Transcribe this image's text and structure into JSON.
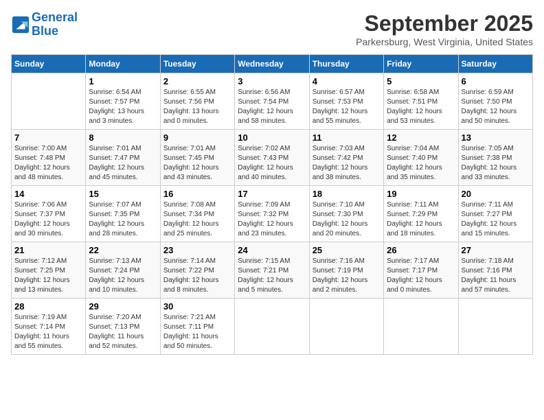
{
  "header": {
    "logo_line1": "General",
    "logo_line2": "Blue",
    "month": "September 2025",
    "location": "Parkersburg, West Virginia, United States"
  },
  "weekdays": [
    "Sunday",
    "Monday",
    "Tuesday",
    "Wednesday",
    "Thursday",
    "Friday",
    "Saturday"
  ],
  "weeks": [
    [
      {
        "day": "",
        "info": ""
      },
      {
        "day": "1",
        "info": "Sunrise: 6:54 AM\nSunset: 7:57 PM\nDaylight: 13 hours\nand 3 minutes."
      },
      {
        "day": "2",
        "info": "Sunrise: 6:55 AM\nSunset: 7:56 PM\nDaylight: 13 hours\nand 0 minutes."
      },
      {
        "day": "3",
        "info": "Sunrise: 6:56 AM\nSunset: 7:54 PM\nDaylight: 12 hours\nand 58 minutes."
      },
      {
        "day": "4",
        "info": "Sunrise: 6:57 AM\nSunset: 7:53 PM\nDaylight: 12 hours\nand 55 minutes."
      },
      {
        "day": "5",
        "info": "Sunrise: 6:58 AM\nSunset: 7:51 PM\nDaylight: 12 hours\nand 53 minutes."
      },
      {
        "day": "6",
        "info": "Sunrise: 6:59 AM\nSunset: 7:50 PM\nDaylight: 12 hours\nand 50 minutes."
      }
    ],
    [
      {
        "day": "7",
        "info": "Sunrise: 7:00 AM\nSunset: 7:48 PM\nDaylight: 12 hours\nand 48 minutes."
      },
      {
        "day": "8",
        "info": "Sunrise: 7:01 AM\nSunset: 7:47 PM\nDaylight: 12 hours\nand 45 minutes."
      },
      {
        "day": "9",
        "info": "Sunrise: 7:01 AM\nSunset: 7:45 PM\nDaylight: 12 hours\nand 43 minutes."
      },
      {
        "day": "10",
        "info": "Sunrise: 7:02 AM\nSunset: 7:43 PM\nDaylight: 12 hours\nand 40 minutes."
      },
      {
        "day": "11",
        "info": "Sunrise: 7:03 AM\nSunset: 7:42 PM\nDaylight: 12 hours\nand 38 minutes."
      },
      {
        "day": "12",
        "info": "Sunrise: 7:04 AM\nSunset: 7:40 PM\nDaylight: 12 hours\nand 35 minutes."
      },
      {
        "day": "13",
        "info": "Sunrise: 7:05 AM\nSunset: 7:38 PM\nDaylight: 12 hours\nand 33 minutes."
      }
    ],
    [
      {
        "day": "14",
        "info": "Sunrise: 7:06 AM\nSunset: 7:37 PM\nDaylight: 12 hours\nand 30 minutes."
      },
      {
        "day": "15",
        "info": "Sunrise: 7:07 AM\nSunset: 7:35 PM\nDaylight: 12 hours\nand 28 minutes."
      },
      {
        "day": "16",
        "info": "Sunrise: 7:08 AM\nSunset: 7:34 PM\nDaylight: 12 hours\nand 25 minutes."
      },
      {
        "day": "17",
        "info": "Sunrise: 7:09 AM\nSunset: 7:32 PM\nDaylight: 12 hours\nand 23 minutes."
      },
      {
        "day": "18",
        "info": "Sunrise: 7:10 AM\nSunset: 7:30 PM\nDaylight: 12 hours\nand 20 minutes."
      },
      {
        "day": "19",
        "info": "Sunrise: 7:11 AM\nSunset: 7:29 PM\nDaylight: 12 hours\nand 18 minutes."
      },
      {
        "day": "20",
        "info": "Sunrise: 7:11 AM\nSunset: 7:27 PM\nDaylight: 12 hours\nand 15 minutes."
      }
    ],
    [
      {
        "day": "21",
        "info": "Sunrise: 7:12 AM\nSunset: 7:25 PM\nDaylight: 12 hours\nand 13 minutes."
      },
      {
        "day": "22",
        "info": "Sunrise: 7:13 AM\nSunset: 7:24 PM\nDaylight: 12 hours\nand 10 minutes."
      },
      {
        "day": "23",
        "info": "Sunrise: 7:14 AM\nSunset: 7:22 PM\nDaylight: 12 hours\nand 8 minutes."
      },
      {
        "day": "24",
        "info": "Sunrise: 7:15 AM\nSunset: 7:21 PM\nDaylight: 12 hours\nand 5 minutes."
      },
      {
        "day": "25",
        "info": "Sunrise: 7:16 AM\nSunset: 7:19 PM\nDaylight: 12 hours\nand 2 minutes."
      },
      {
        "day": "26",
        "info": "Sunrise: 7:17 AM\nSunset: 7:17 PM\nDaylight: 12 hours\nand 0 minutes."
      },
      {
        "day": "27",
        "info": "Sunrise: 7:18 AM\nSunset: 7:16 PM\nDaylight: 11 hours\nand 57 minutes."
      }
    ],
    [
      {
        "day": "28",
        "info": "Sunrise: 7:19 AM\nSunset: 7:14 PM\nDaylight: 11 hours\nand 55 minutes."
      },
      {
        "day": "29",
        "info": "Sunrise: 7:20 AM\nSunset: 7:13 PM\nDaylight: 11 hours\nand 52 minutes."
      },
      {
        "day": "30",
        "info": "Sunrise: 7:21 AM\nSunset: 7:11 PM\nDaylight: 11 hours\nand 50 minutes."
      },
      {
        "day": "",
        "info": ""
      },
      {
        "day": "",
        "info": ""
      },
      {
        "day": "",
        "info": ""
      },
      {
        "day": "",
        "info": ""
      }
    ]
  ]
}
